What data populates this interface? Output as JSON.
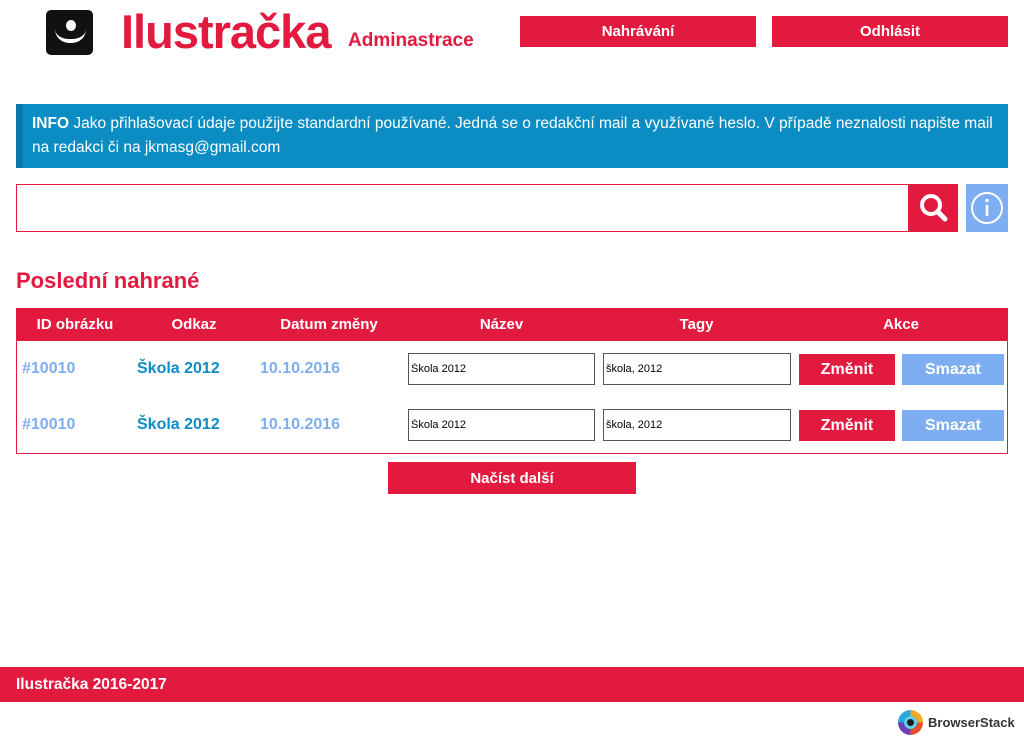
{
  "header": {
    "title": "Ilustračka",
    "subtitle": "Adminastrace",
    "upload_label": "Nahrávání",
    "logout_label": "Odhlásit"
  },
  "info": {
    "label": "INFO",
    "text": "Jako přihlašovací údaje použijte standardní používané. Jedná se o redakční mail a využívané heslo. V případě neznalosti napište mail na redakci či na jkmasg@gmail.com"
  },
  "search": {
    "value": "",
    "icon": "search-icon",
    "info_icon": "info-icon"
  },
  "section_title": "Poslední nahrané",
  "table": {
    "columns": [
      "ID obrázku",
      "Odkaz",
      "Datum změny",
      "Název",
      "Tagy",
      "Akce"
    ],
    "rows": [
      {
        "id": "#10010",
        "link": "Škola 2012",
        "date": "10.10.2016",
        "name": "Škola 2012",
        "tags": "škola, 2012",
        "edit": "Změnit",
        "delete": "Smazat"
      },
      {
        "id": "#10010",
        "link": "Škola 2012",
        "date": "10.10.2016",
        "name": "Škola 2012",
        "tags": "škola, 2012",
        "edit": "Změnit",
        "delete": "Smazat"
      }
    ]
  },
  "load_more_label": "Načíst další",
  "footer": {
    "text": "Ilustračka 2016-2017"
  },
  "browserstack": {
    "label": "BrowserStack"
  },
  "colors": {
    "brand": "#e31a40",
    "info": "#0b8cc2",
    "secondary": "#7eaef2"
  }
}
